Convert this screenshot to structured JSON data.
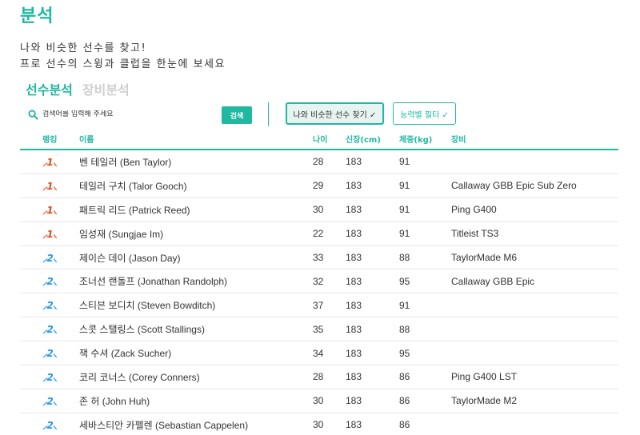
{
  "page": {
    "title": "분석",
    "intro_line1": "나와 비슷한 선수를 찾고!",
    "intro_line2": "프로 선수의 스윙과 클럽을 한눈에 보세요"
  },
  "tabs": [
    {
      "label": "선수분석",
      "active": true
    },
    {
      "label": "장비분석",
      "active": false
    }
  ],
  "search": {
    "placeholder": "검색어를 입력해 주세요",
    "button": "검색"
  },
  "filters": {
    "similar": "나와 비슷한 선수 찾기 ✓",
    "ability": "능력별 필터 ✓"
  },
  "table": {
    "headers": {
      "rank": "랭킹",
      "name": "이름",
      "age": "나이",
      "height": "신장(cm)",
      "weight": "체중(kg)",
      "gear": "장비"
    },
    "rows": [
      {
        "rank": "1",
        "name": "벤 테일러 (Ben Taylor)",
        "age": "28",
        "height": "183",
        "weight": "91",
        "gear": ""
      },
      {
        "rank": "1",
        "name": "테일러 구치 (Talor Gooch)",
        "age": "29",
        "height": "183",
        "weight": "91",
        "gear": "Callaway GBB Epic Sub Zero"
      },
      {
        "rank": "1",
        "name": "패트릭 리드 (Patrick Reed)",
        "age": "30",
        "height": "183",
        "weight": "91",
        "gear": "Ping G400"
      },
      {
        "rank": "1",
        "name": "임성재 (Sungjae Im)",
        "age": "22",
        "height": "183",
        "weight": "91",
        "gear": "Titleist TS3"
      },
      {
        "rank": "2",
        "name": "제이슨 데이 (Jason Day)",
        "age": "33",
        "height": "183",
        "weight": "88",
        "gear": "TaylorMade M6"
      },
      {
        "rank": "2",
        "name": "조너선 랜돌프 (Jonathan Randolph)",
        "age": "32",
        "height": "183",
        "weight": "95",
        "gear": "Callaway GBB Epic"
      },
      {
        "rank": "2",
        "name": "스티븐 보디치 (Steven Bowditch)",
        "age": "37",
        "height": "183",
        "weight": "91",
        "gear": ""
      },
      {
        "rank": "2",
        "name": "스콧 스탤링스 (Scott Stallings)",
        "age": "35",
        "height": "183",
        "weight": "88",
        "gear": ""
      },
      {
        "rank": "2",
        "name": "잭 수셔 (Zack Sucher)",
        "age": "34",
        "height": "183",
        "weight": "95",
        "gear": ""
      },
      {
        "rank": "2",
        "name": "코리 코너스 (Corey Conners)",
        "age": "28",
        "height": "183",
        "weight": "86",
        "gear": "Ping G400 LST"
      },
      {
        "rank": "2",
        "name": "존 허 (John Huh)",
        "age": "30",
        "height": "183",
        "weight": "86",
        "gear": "TaylorMade M2"
      },
      {
        "rank": "2",
        "name": "세바스티안 카펠렌 (Sebastian Cappelen)",
        "age": "30",
        "height": "183",
        "weight": "86",
        "gear": ""
      }
    ]
  },
  "colors": {
    "accent": "#21b8a0",
    "rank1": "#e64a19",
    "rank2": "#2196f3"
  }
}
